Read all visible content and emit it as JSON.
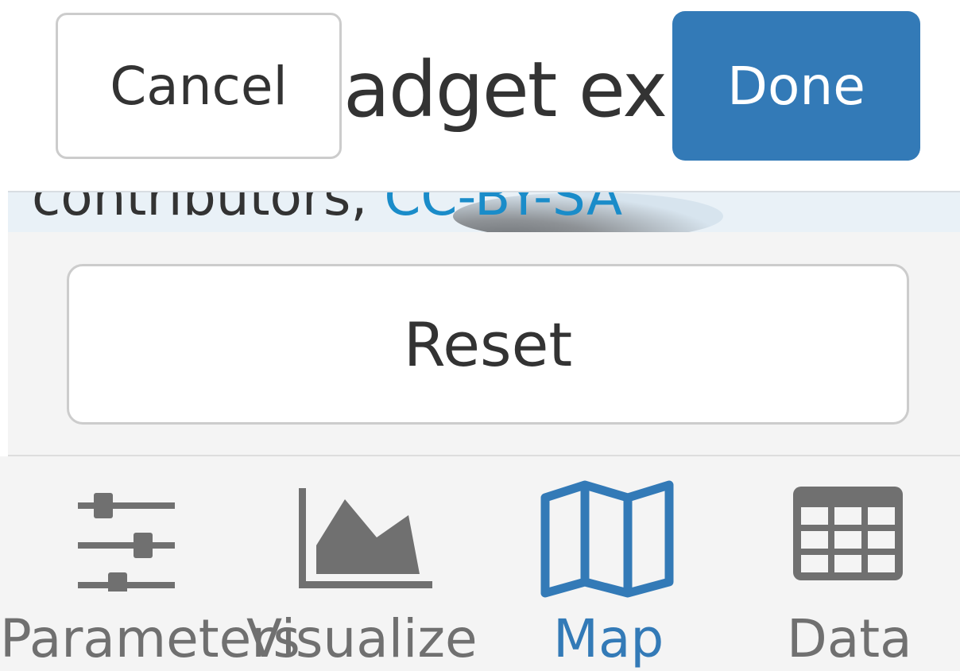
{
  "header": {
    "title": "adget ex",
    "cancel_label": "Cancel",
    "done_label": "Done"
  },
  "map": {
    "attribution_prefix": "contributors,",
    "attribution_license": "CC-BY-SA"
  },
  "controls": {
    "reset_label": "Reset"
  },
  "tabs": [
    {
      "label": "Parameters",
      "icon": "sliders-icon",
      "active": false
    },
    {
      "label": "Visualize",
      "icon": "area-chart-icon",
      "active": false
    },
    {
      "label": "Map",
      "icon": "map-icon",
      "active": true
    },
    {
      "label": "Data",
      "icon": "table-icon",
      "active": false
    }
  ],
  "colors": {
    "accent": "#337ab7",
    "inactive_tab": "#707070",
    "link": "#1a8cc9"
  }
}
